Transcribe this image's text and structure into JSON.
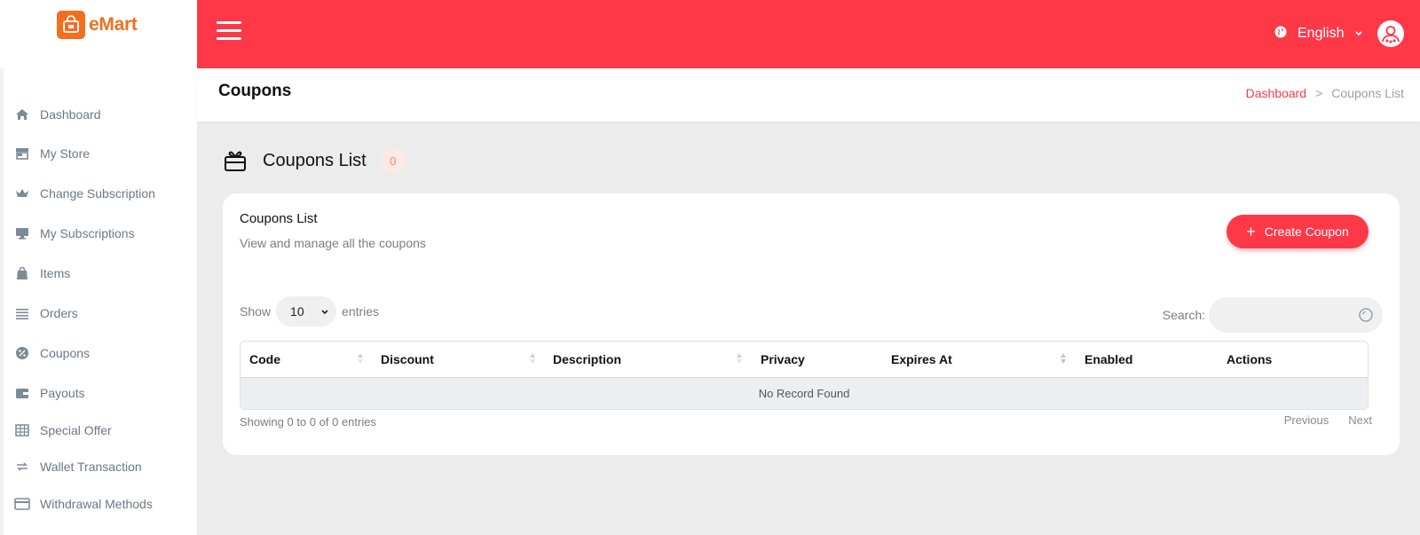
{
  "app": {
    "name": "eMart",
    "brand_color": "#ff3848",
    "logo_color": "#f26f21"
  },
  "sidebar": {
    "items": [
      {
        "label": "Dashboard",
        "icon": "home-icon"
      },
      {
        "label": "My Store",
        "icon": "store-icon"
      },
      {
        "label": "Change Subscription",
        "icon": "crown-icon"
      },
      {
        "label": "My Subscriptions",
        "icon": "monitor-icon"
      },
      {
        "label": "Items",
        "icon": "bag-icon"
      },
      {
        "label": "Orders",
        "icon": "list-icon"
      },
      {
        "label": "Coupons",
        "icon": "coupon-badge-icon"
      },
      {
        "label": "Payouts",
        "icon": "wallet-icon"
      },
      {
        "label": "Special Offer",
        "icon": "table-icon"
      },
      {
        "label": "Wallet Transaction",
        "icon": "transfer-icon"
      },
      {
        "label": "Withdrawal Methods",
        "icon": "card-icon"
      }
    ]
  },
  "topbar": {
    "language": "English"
  },
  "page": {
    "title": "Coupons",
    "breadcrumb": {
      "home": "Dashboard",
      "separator": ">",
      "current": "Coupons List"
    }
  },
  "section": {
    "title": "Coupons List",
    "count": "0"
  },
  "card": {
    "title": "Coupons List",
    "subtitle": "View and manage all the coupons",
    "create_button": "Create Coupon",
    "create_plus": "+"
  },
  "table_controls": {
    "show_label": "Show",
    "entries_value": "10",
    "entries_label": "entries",
    "search_label": "Search:"
  },
  "table": {
    "columns": [
      "Code",
      "Discount",
      "Description",
      "Privacy",
      "Expires At",
      "Enabled",
      "Actions"
    ],
    "empty_message": "No Record Found"
  },
  "footer": {
    "showing": "Showing 0 to 0 of 0 entries",
    "previous": "Previous",
    "next": "Next"
  }
}
